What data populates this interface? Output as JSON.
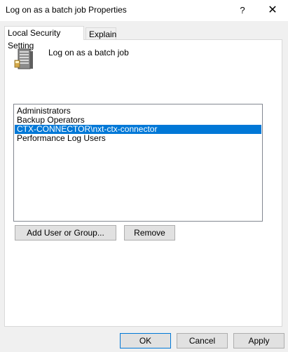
{
  "window": {
    "title": "Log on as a batch job Properties",
    "help_label": "?",
    "close_label": "✕"
  },
  "tabs": [
    {
      "label": "Local Security Setting"
    },
    {
      "label": "Explain"
    }
  ],
  "policy": {
    "name": "Log on as a batch job",
    "icon": "server-icon"
  },
  "members": [
    {
      "label": "Administrators"
    },
    {
      "label": "Backup Operators"
    },
    {
      "label": "CTX-CONNECTOR\\nxt-ctx-connector"
    },
    {
      "label": "Performance Log Users"
    }
  ],
  "selected_member": "CTX-CONNECTOR\\nxt-ctx-connector",
  "actions": {
    "add_label": "Add User or Group...",
    "remove_label": "Remove"
  },
  "footer": {
    "ok_label": "OK",
    "cancel_label": "Cancel",
    "apply_label": "Apply"
  },
  "colors": {
    "selection": "#0078d7",
    "window_bg": "#f0f0f0"
  }
}
